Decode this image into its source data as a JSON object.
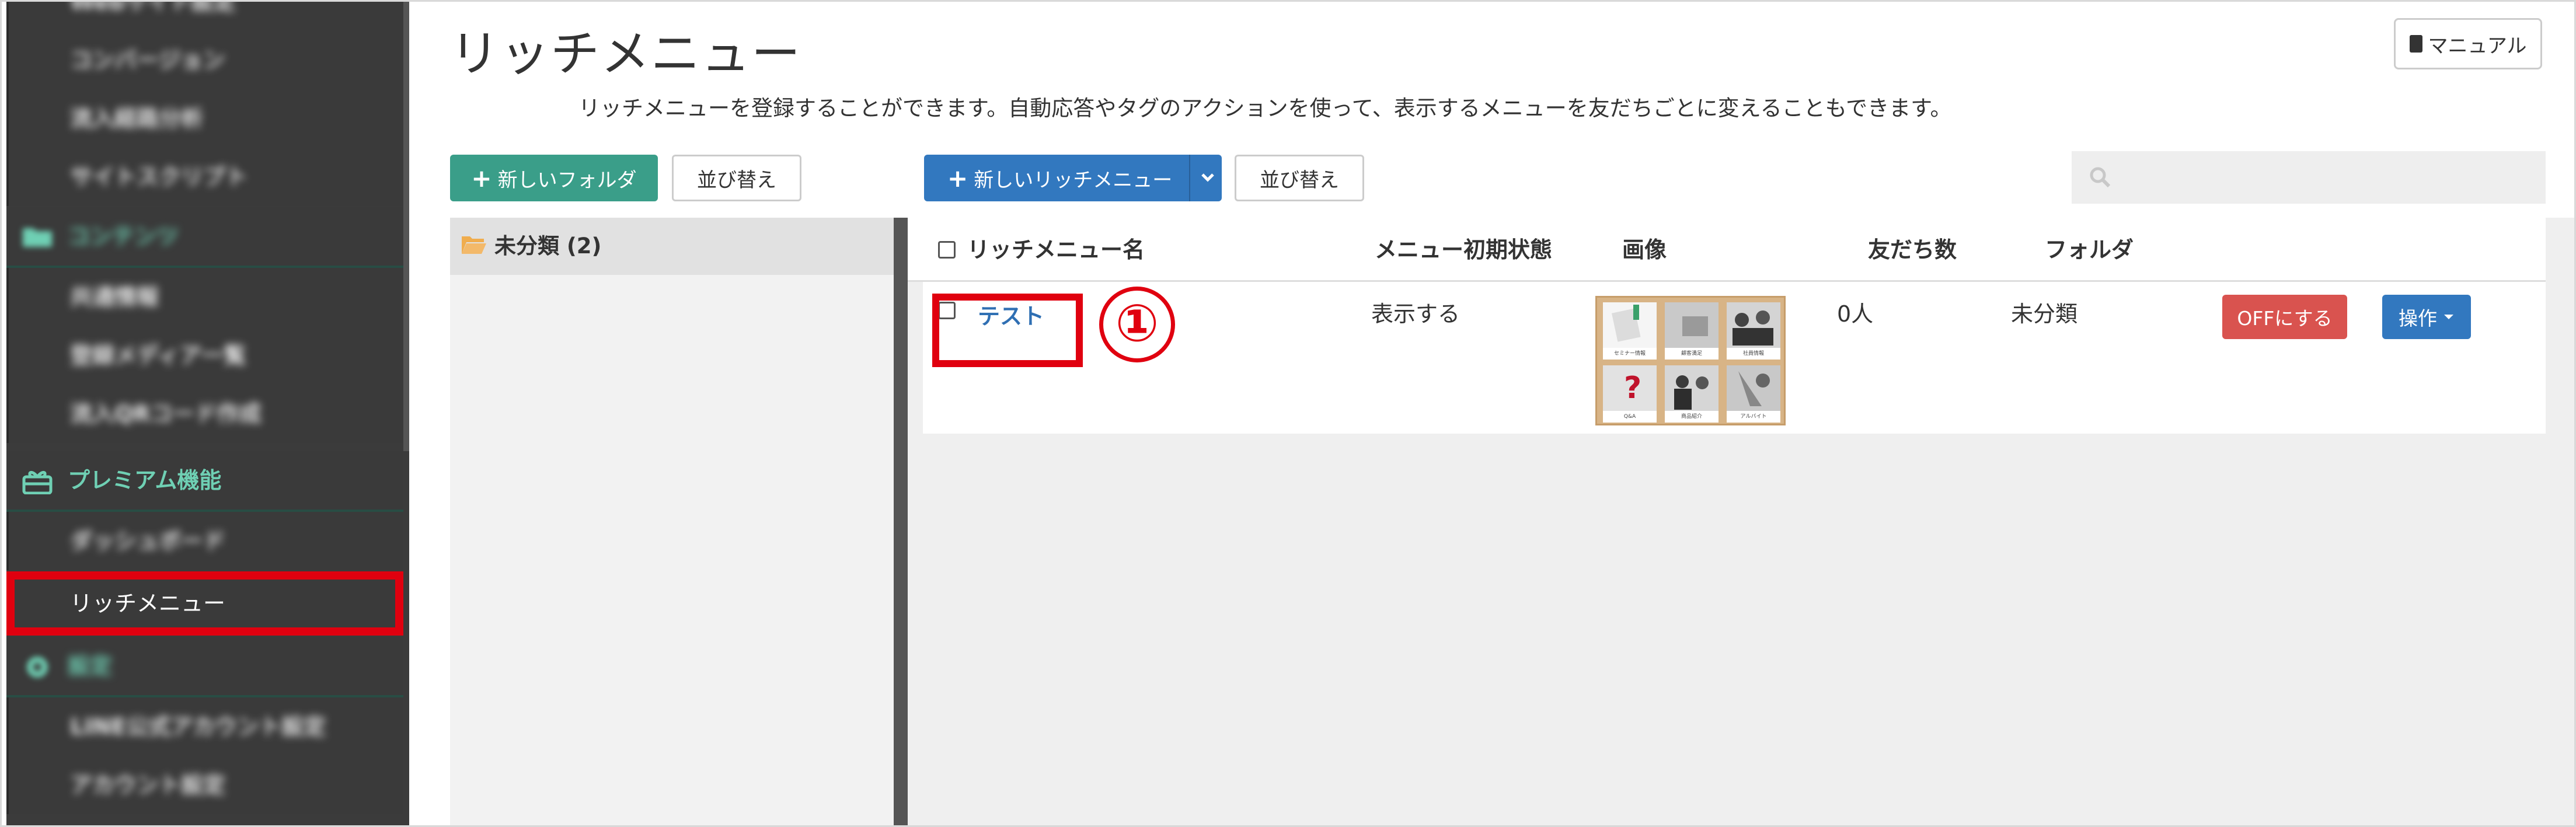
{
  "sidebar": {
    "items": [
      {
        "label": "Webサイト設定",
        "type": "sub"
      },
      {
        "label": "コンバージョン",
        "type": "sub"
      },
      {
        "label": "流入経路分析",
        "type": "sub"
      },
      {
        "label": "サイトスクリプト",
        "type": "sub"
      },
      {
        "label": "コンテンツ",
        "type": "head",
        "icon": "folder-icon"
      },
      {
        "label": "共通情報",
        "type": "sub"
      },
      {
        "label": "登録メディア一覧",
        "type": "sub"
      },
      {
        "label": "流入QRコード作成",
        "type": "sub"
      },
      {
        "label": "プレミアム機能",
        "type": "head",
        "icon": "gift-icon"
      },
      {
        "label": "ダッシュボード",
        "type": "sub"
      },
      {
        "label": "リッチメニュー",
        "type": "sub",
        "active": true
      },
      {
        "label": "設定",
        "type": "head",
        "icon": "gear-icon"
      },
      {
        "label": "LINE公式アカウント設定",
        "type": "sub"
      },
      {
        "label": "アカウント設定",
        "type": "sub"
      }
    ]
  },
  "page": {
    "title": "リッチメニュー",
    "description": "リッチメニューを登録することができます。自動応答やタグのアクションを使って、表示するメニューを友だちごとに変えることもできます。",
    "manual_label": "マニュアル"
  },
  "toolbar": {
    "new_folder_label": "新しいフォルダ",
    "sort_label_left": "並び替え",
    "new_richmenu_label": "新しいリッチメニュー",
    "sort_label_right": "並び替え",
    "search_placeholder": ""
  },
  "folders": [
    {
      "name": "未分類 (2)"
    }
  ],
  "table": {
    "headers": {
      "name": "リッチメニュー名",
      "initial_state": "メニュー初期状態",
      "image": "画像",
      "friends": "友だち数",
      "folder": "フォルダ"
    },
    "rows": [
      {
        "name": "テスト",
        "initial_state": "表示する",
        "friends": "0人",
        "folder": "未分類",
        "off_button": "OFFにする",
        "action_button": "操作"
      }
    ]
  },
  "annotation": {
    "marker": "①"
  },
  "thumbnail": {
    "captions": [
      "セミナー情報",
      "顧客満足",
      "社員情報",
      "Q&A",
      "商品紹介",
      "アルバイト"
    ]
  },
  "colors": {
    "accent_green": "#3a9e89",
    "accent_blue": "#3278bf",
    "danger_red": "#d9534f",
    "highlight_red": "#e0000f",
    "sidebar_bg": "#3b3b3b",
    "sidebar_head_text": "#6fd0b4"
  }
}
